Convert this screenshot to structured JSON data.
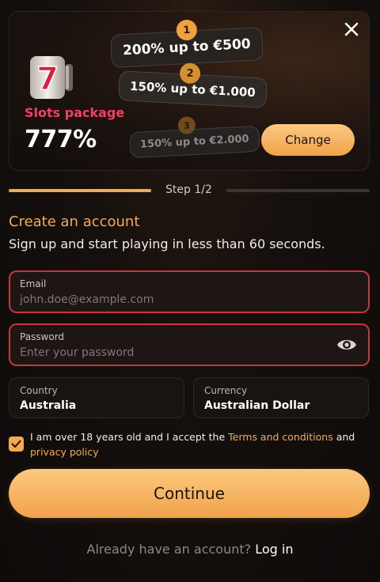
{
  "promo": {
    "package_name": "Slots package",
    "package_value": "777%",
    "tiers": [
      {
        "number": "1",
        "label": "200% up to €500"
      },
      {
        "number": "2",
        "label": "150% up to €1.000"
      },
      {
        "number": "3",
        "label": "150% up to €2.000"
      }
    ],
    "change_label": "Change"
  },
  "progress": {
    "step_label": "Step 1/2",
    "fraction_complete": 0.5
  },
  "form": {
    "title": "Create an account",
    "subtitle": "Sign up and start playing in less than 60 seconds.",
    "email": {
      "label": "Email",
      "placeholder": "john.doe@example.com",
      "value": ""
    },
    "password": {
      "label": "Password",
      "placeholder": "Enter your password",
      "value": ""
    },
    "country": {
      "label": "Country",
      "value": "Australia"
    },
    "currency": {
      "label": "Currency",
      "value": "Australian Dollar"
    },
    "terms": {
      "checked": true,
      "prefix": "I am over 18 years old and I accept the ",
      "terms_link": "Terms and conditions",
      "middle": " and ",
      "privacy_link": "privacy policy"
    },
    "continue_label": "Continue"
  },
  "footer": {
    "prompt": "Already have an account?",
    "login_link": "Log in"
  },
  "colors": {
    "accent": "#f4ab53",
    "error_border": "#c9343f",
    "package_name": "#f2405f"
  },
  "icons": {
    "close": "close-icon",
    "slot_machine": "slot-machine-icon",
    "password_visibility": "eye-icon",
    "checkbox": "checkmark-icon"
  }
}
